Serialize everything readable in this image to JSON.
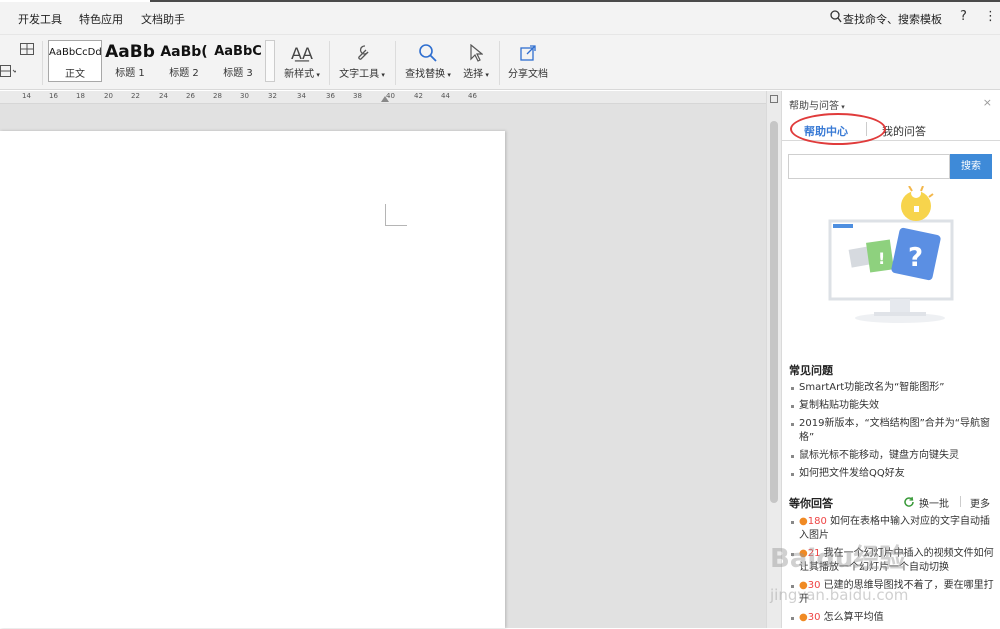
{
  "menubar": {
    "items": [
      "开发工具",
      "特色应用",
      "文档助手"
    ],
    "search_label": "查找命令、搜索模板",
    "help_icon": "?",
    "more_icon": "⋮"
  },
  "ribbon": {
    "styles": [
      {
        "sample": "AaBbCcDd",
        "label": "正文"
      },
      {
        "sample": "AaBb",
        "label": "标题 1"
      },
      {
        "sample": "AaBb(",
        "label": "标题 2"
      },
      {
        "sample": "AaBbC",
        "label": "标题 3"
      }
    ],
    "new_style": "新样式",
    "text_tools": "文字工具",
    "find_replace": "查找替换",
    "select": "选择",
    "share_doc": "分享文档"
  },
  "ruler": {
    "ticks": [
      "14",
      "16",
      "18",
      "20",
      "22",
      "24",
      "26",
      "28",
      "30",
      "32",
      "34",
      "36",
      "38",
      "40",
      "42",
      "44",
      "46"
    ]
  },
  "panel": {
    "title": "帮助与问答",
    "close_icon": "×",
    "tabs": [
      "帮助中心",
      "我的问答"
    ],
    "search_button": "搜索",
    "faq_title": "常见问题",
    "faq_items": [
      "SmartArt功能改名为“智能图形”",
      "复制粘贴功能失效",
      "2019新版本，“文档结构图”合并为“导航窗格”",
      "鼠标光标不能移动，键盘方向键失灵",
      "如何把文件发给QQ好友"
    ],
    "answers_title": "等你回答",
    "refresh_label": "换一批",
    "more_label": "更多",
    "answers": [
      {
        "points": "180",
        "text": "如何在表格中输入对应的文字自动插入图片"
      },
      {
        "points": "21",
        "text": "我在一个幻灯片中插入的视频文件如何让其播放一个幻灯片一个自动切换"
      },
      {
        "points": "30",
        "text": "已建的思维导图找不着了，要在哪里打开"
      },
      {
        "points": "30",
        "text": "怎么算平均值"
      }
    ]
  },
  "watermark": {
    "line1": "Baidu经验",
    "line2": "jingyan.baidu.com"
  },
  "colors": {
    "accent": "#3e8ad8",
    "highlight_oval": "#e03b3b",
    "points": "#e44"
  }
}
